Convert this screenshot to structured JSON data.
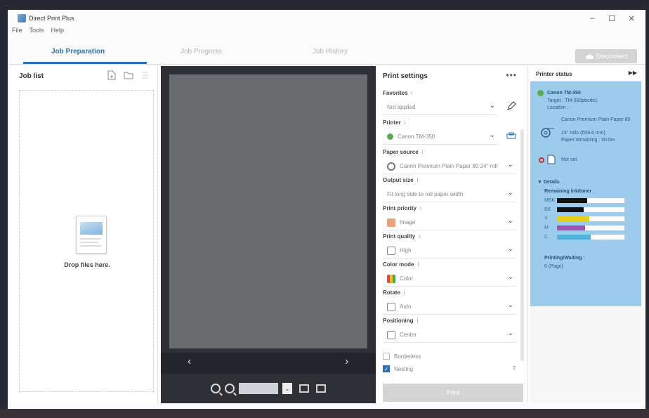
{
  "window": {
    "title": "Direct Print Plus"
  },
  "menu": [
    "File",
    "Tools",
    "Help"
  ],
  "tabs": [
    {
      "label": "Job Preparation",
      "active": true
    },
    {
      "label": "Job Progress",
      "active": false
    },
    {
      "label": "Job History",
      "active": false
    }
  ],
  "disconnect_label": "Disconnect",
  "job_list": {
    "title": "Job list",
    "drop_text": "Drop files here."
  },
  "preview": {
    "zoom_value": ""
  },
  "print_settings": {
    "title": "Print settings",
    "favorites": {
      "label": "Favorites",
      "value": "Not applied"
    },
    "printer": {
      "label": "Printer",
      "value": "Canon TM-350"
    },
    "paper_source": {
      "label": "Paper source",
      "value": "Canon Premium Plain Paper 80 24\" roll"
    },
    "output_size": {
      "label": "Output size",
      "value": "Fit long side to roll paper width"
    },
    "print_priority": {
      "label": "Print priority",
      "value": "Image"
    },
    "print_quality": {
      "label": "Print quality",
      "value": "High"
    },
    "color_mode": {
      "label": "Color mode",
      "value": "Color"
    },
    "rotate": {
      "label": "Rotate",
      "value": "Auto"
    },
    "positioning": {
      "label": "Positioning",
      "value": "Center"
    },
    "borderless": {
      "label": "Borderless",
      "checked": false
    },
    "nesting": {
      "label": "Nesting",
      "checked": true
    },
    "print_button": "Print"
  },
  "printer_status": {
    "title": "Printer status",
    "printer_name": "Canon TM-350",
    "target": "Target : TM-350pbcds1",
    "location": "Location :",
    "roll_paper": "Canon Premium Plain Paper 80",
    "roll_size": "24\" rolls (609.6 mm)",
    "paper_remaining": "Paper remaining : 50.0m",
    "sheet_status": "Not set",
    "details_label": "Details",
    "ink_title": "Remaining ink/toner",
    "inks": [
      {
        "name": "MBK",
        "level": 0.45,
        "color": "#111111"
      },
      {
        "name": "BK",
        "level": 0.4,
        "color": "#111111"
      },
      {
        "name": "Y",
        "level": 0.48,
        "color": "#e8cf1e"
      },
      {
        "name": "M",
        "level": 0.42,
        "color": "#a64fb5"
      },
      {
        "name": "C",
        "level": 0.5,
        "color": "#4fb3dc"
      }
    ],
    "printing_waiting_label": "Printing/Waiting :",
    "printing_waiting_value": "0 (Page)"
  }
}
